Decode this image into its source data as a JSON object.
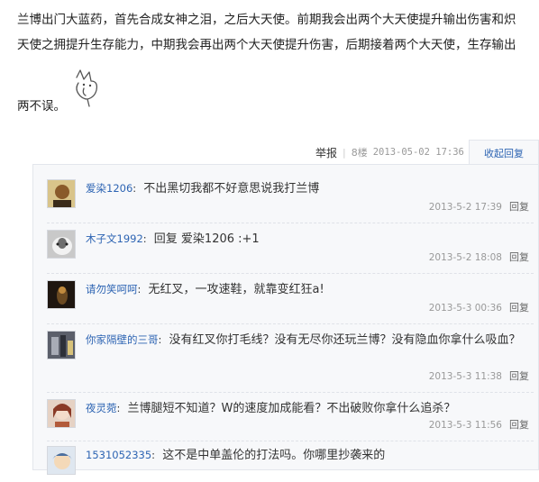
{
  "post": {
    "line1": "兰博出门大蓝药，首先合成女神之泪，之后大天使。前期我会出两个大天使提升输出伤害和炽",
    "line2": "天使之拥提升生存能力，中期我会再出两个大天使提升伤害，后期接着两个大天使，生存输出",
    "line3": "两不误。",
    "emoticon_icon": "hand-drawn-emoticon"
  },
  "post_tail": {
    "report": "举报",
    "floor": "8楼",
    "date": "2013-05-02 17:36",
    "collapse_replies": "收起回复"
  },
  "replies": [
    {
      "user": "爱染1206",
      "text": "不出黑切我都不好意思说我打兰博",
      "time": "2013-5-2 17:39",
      "reply_label": "回复",
      "avatar_color": "#c9a25a"
    },
    {
      "user": "木子文1992",
      "text": "回复 爱染1206 :+1",
      "time": "2013-5-2 18:08",
      "reply_label": "回复",
      "avatar_color": "#8f8f8f"
    },
    {
      "user": "请勿笑呵呵",
      "text": "无红叉，一攻速鞋，就靠变红狂a!",
      "time": "2013-5-3 00:36",
      "reply_label": "回复",
      "avatar_color": "#3a2a1e"
    },
    {
      "user": "你家隔壁的三哥",
      "text": "没有红叉你打毛线？没有无尽你还玩兰博？没有隐血你拿什么吸血？",
      "time": "2013-5-3 11:38",
      "reply_label": "回复",
      "avatar_color": "#6b6e78"
    },
    {
      "user": "夜灵菀",
      "text": "兰博腿短不知道？W的速度加成能看？不出破败你拿什么追杀？",
      "time": "2013-5-3 11:56",
      "reply_label": "回复",
      "avatar_color": "#b86a4a"
    },
    {
      "user": "1531052335",
      "text": "这不是中单盖伦的打法吗。你哪里抄袭来的",
      "time": "",
      "reply_label": "",
      "avatar_color": "#9bb0c8"
    }
  ]
}
